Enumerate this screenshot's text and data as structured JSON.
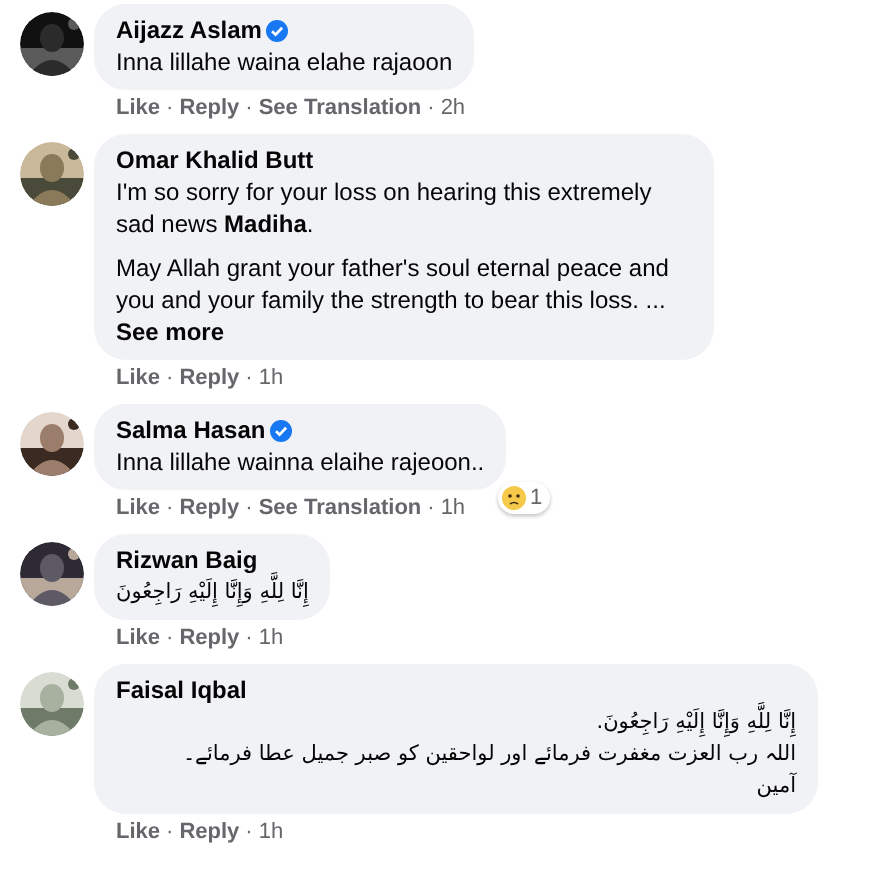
{
  "separator": "·",
  "comments": [
    {
      "name": "Aijazz Aslam",
      "verified": true,
      "kind": "latin",
      "paragraphs": [
        "Inna lillahe waina elahe rajaoon"
      ],
      "actions": [
        "Like",
        "Reply",
        "See Translation"
      ],
      "time": "2h"
    },
    {
      "name": "Omar Khalid Butt",
      "verified": false,
      "kind": "latin",
      "paragraphs": [
        "I'm so sorry for your loss on hearing this extremely sad news **Madiha**.",
        "May Allah grant your father's soul eternal peace and you and your family the strength to bear this loss. ..."
      ],
      "more": "See more",
      "actions": [
        "Like",
        "Reply"
      ],
      "time": "1h"
    },
    {
      "name": "Salma Hasan",
      "verified": true,
      "kind": "latin",
      "paragraphs": [
        "Inna lillahe wainna elaihe rajeoon.."
      ],
      "reaction": {
        "count": "1"
      },
      "actions": [
        "Like",
        "Reply",
        "See Translation"
      ],
      "time": "1h"
    },
    {
      "name": "Rizwan Baig",
      "verified": false,
      "kind": "arabic",
      "paragraphs": [
        "إِنَّا لِلَّهِ وَإِنَّا إِلَيْهِ رَاجِعُونَ"
      ],
      "actions": [
        "Like",
        "Reply"
      ],
      "time": "1h"
    },
    {
      "name": "Faisal Iqbal",
      "verified": false,
      "kind": "arabic",
      "paragraphs": [
        "إِنَّا لِلَّهِ وَإِنَّا إِلَيْهِ رَاجِعُونَ.\nاللہ رب العزت مغفرت فرمائے اور لواحقین کو صبر جمیل عطا فرمائے۔\nآمین"
      ],
      "actions": [
        "Like",
        "Reply"
      ],
      "time": "1h"
    }
  ]
}
